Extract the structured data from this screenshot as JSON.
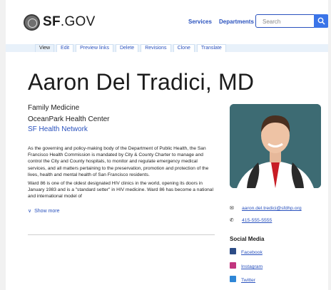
{
  "header": {
    "logo_bold": "SF",
    "logo_rest": ".GOV",
    "nav": [
      "Services",
      "Departments"
    ],
    "search_placeholder": "Search"
  },
  "tabs": [
    "View",
    "Edit",
    "Preview links",
    "Delete",
    "Revisions",
    "Clone",
    "Translate"
  ],
  "page": {
    "title": "Aaron Del Tradici, MD",
    "roles": [
      "Family Medicine",
      "OceanPark Health Center"
    ],
    "network_link": "SF Health Network",
    "paragraphs": [
      "As the governing and policy-making body of the Department of Public Health, the San Francisco Health Commission is mandated by City & County Charter to manage and control the City and County hospitals, to monitor and regulate emergency medical services, and all matters pertaining to the preservation, promotion and protection of the lives, health and mental health of San Francisco residents.",
      "Ward 86 is one of the oldest designated HIV clinics in the world, opening its doors in January 1983 and is a \"standard setter\" in HIV medicine. Ward 86 has become a national and international model of"
    ],
    "show_more": "Show more"
  },
  "contact": {
    "email": "aaron.del.tredici@sfdhp.org",
    "phone": "415-555-5555"
  },
  "social": {
    "heading": "Social Media",
    "links": [
      "Facebook",
      "Instagram",
      "Twitter"
    ]
  },
  "colors": {
    "link": "#2a52be",
    "search_button": "#3a74e8",
    "tab_bar": "#e8f1fa"
  }
}
